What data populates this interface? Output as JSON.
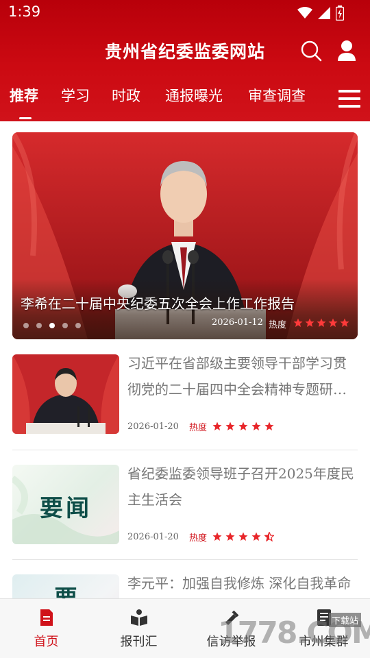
{
  "status_bar": {
    "time": "1:39"
  },
  "header": {
    "title": "贵州省纪委监委网站"
  },
  "tabs": [
    {
      "label": "推荐",
      "active": true
    },
    {
      "label": "学习",
      "active": false
    },
    {
      "label": "时政",
      "active": false
    },
    {
      "label": "通报曝光",
      "active": false
    },
    {
      "label": "审查调查",
      "active": false
    }
  ],
  "banner": {
    "title": "李希在二十届中央纪委五次全会上作工作报告",
    "date": "2026-01-12",
    "heat_label": "热度",
    "heat_stars": 5,
    "slide_count": 5,
    "active_slide": 3
  },
  "news": [
    {
      "title": "习近平在省部级主要领导干部学习贯彻党的二十届四中全会精神专题研…",
      "date": "2026-01-20",
      "heat_label": "热度",
      "heat_stars": 5
    },
    {
      "title": "省纪委监委领导班子召开2025年度民主生活会",
      "date": "2026-01-20",
      "heat_label": "热度",
      "heat_stars": 4.5,
      "thumb_text": "要闻"
    },
    {
      "title": "李元平：加强自我修炼 深化自我革命",
      "thumb_text": "要"
    }
  ],
  "bottom_nav": [
    {
      "label": "首页",
      "active": true,
      "icon": "document-icon"
    },
    {
      "label": "报刊汇",
      "active": false,
      "icon": "book-icon"
    },
    {
      "label": "信访举报",
      "active": false,
      "icon": "report-icon"
    },
    {
      "label": "市州集群",
      "active": false,
      "icon": "list-icon"
    }
  ],
  "watermark": {
    "text": "1778.COM",
    "tag": "下载站"
  },
  "colors": {
    "brand_red": "#d0121a",
    "star_red": "#e8262a",
    "text_gray": "#777777"
  }
}
